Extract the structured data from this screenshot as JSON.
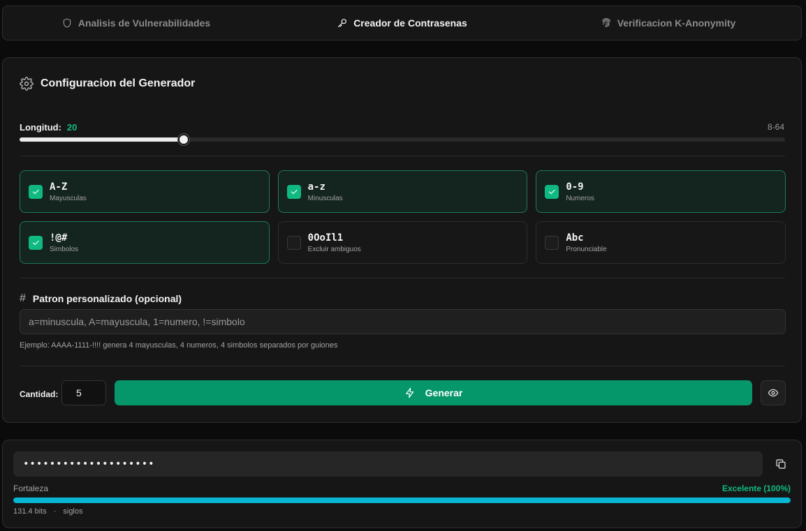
{
  "tabs": [
    {
      "label": "Analisis de Vulnerabilidades",
      "icon": "shield-icon",
      "active": false
    },
    {
      "label": "Creador de Contrasenas",
      "icon": "key-icon",
      "active": true
    },
    {
      "label": "Verificacion K-Anonymity",
      "icon": "fingerprint-icon",
      "active": false
    }
  ],
  "config": {
    "title": "Configuracion del Generador",
    "icon": "gear-icon",
    "length_label": "Longitud:",
    "length_value": "20",
    "length_min": 8,
    "length_max": 64,
    "length_range": "8-64"
  },
  "options": [
    {
      "main": "A-Z",
      "sub": "Mayusculas",
      "checked": true
    },
    {
      "main": "a-z",
      "sub": "Minusculas",
      "checked": true
    },
    {
      "main": "0-9",
      "sub": "Numeros",
      "checked": true
    },
    {
      "main": "!@#",
      "sub": "Simbolos",
      "checked": true
    },
    {
      "main": "0OoIl1",
      "sub": "Excluir ambiguos",
      "checked": false
    },
    {
      "main": "Abc",
      "sub": "Pronunciable",
      "checked": false
    }
  ],
  "pattern": {
    "icon": "hash-icon",
    "title": "Patron personalizado (opcional)",
    "placeholder": "a=minuscula, A=mayuscula, 1=numero, !=simbolo",
    "value": "",
    "hint": "Ejemplo: AAAA-1111-!!!! genera 4 mayusculas, 4 numeros, 4 simbolos separados por guiones"
  },
  "actions": {
    "quantity_label": "Cantidad:",
    "quantity_value": "5",
    "generate_label": "Generar",
    "generate_icon": "zap-icon",
    "toggle_icon": "eye-icon"
  },
  "result": {
    "password_masked": "••••••••••••••••••••",
    "copy_icon": "copy-icon",
    "strength_label": "Fortaleza",
    "strength_value": "Excelente (100%)",
    "strength_percent": 100,
    "strength_color": "#06b6d4",
    "bits": "131.4 bits",
    "separator": "·",
    "crack_time": "siglos"
  },
  "colors": {
    "accent": "#10b981",
    "button": "#059669",
    "strength_bar": "#06b6d4"
  }
}
